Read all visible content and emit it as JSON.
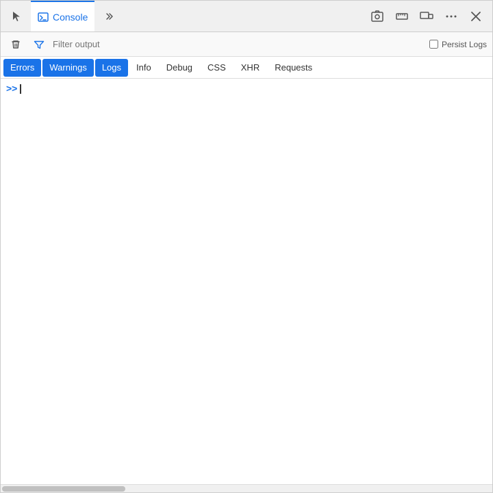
{
  "topToolbar": {
    "cursorToolLabel": "Cursor tool",
    "consoleTabLabel": "Console",
    "moreTabsLabel": "More tabs",
    "screenshotLabel": "Screenshot",
    "rulerLabel": "Ruler",
    "responsiveLabel": "Responsive design mode",
    "moreOptionsLabel": "More options",
    "closeLabel": "Close"
  },
  "filterBar": {
    "clearLabel": "Clear Web Console output",
    "filterLabel": "Filter",
    "filterPlaceholder": "Filter output",
    "persistLogsLabel": "Persist Logs"
  },
  "logTabs": [
    {
      "id": "errors",
      "label": "Errors",
      "active": true
    },
    {
      "id": "warnings",
      "label": "Warnings",
      "active": true
    },
    {
      "id": "logs",
      "label": "Logs",
      "active": true
    },
    {
      "id": "info",
      "label": "Info",
      "active": false
    },
    {
      "id": "debug",
      "label": "Debug",
      "active": false
    },
    {
      "id": "css",
      "label": "CSS",
      "active": false
    },
    {
      "id": "xhr",
      "label": "XHR",
      "active": false
    },
    {
      "id": "requests",
      "label": "Requests",
      "active": false
    }
  ],
  "console": {
    "promptSymbol": ">>",
    "emptyContent": ""
  }
}
